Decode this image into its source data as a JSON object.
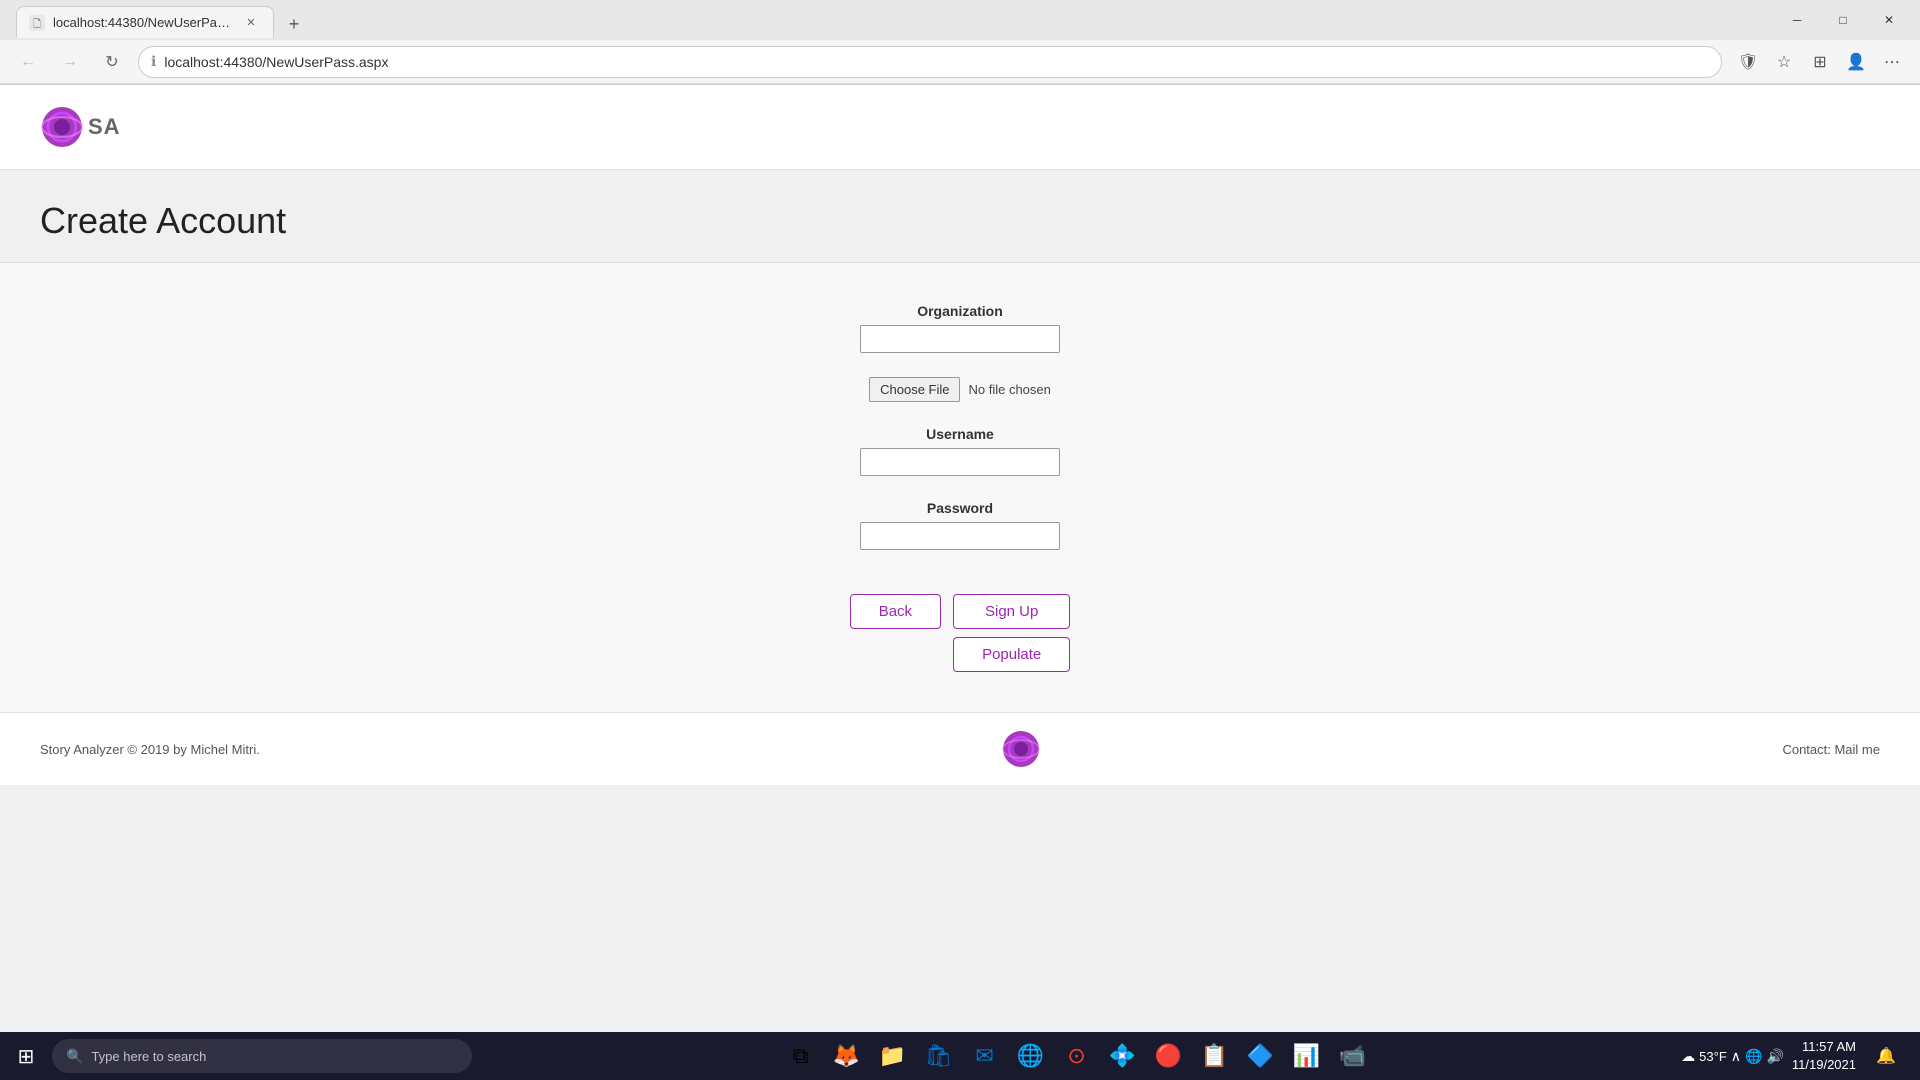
{
  "browser": {
    "tab_title": "localhost:44380/NewUserPass.as...",
    "url": "localhost:44380/NewUserPass.aspx",
    "new_tab_icon": "+",
    "nav": {
      "back_label": "←",
      "forward_label": "→",
      "refresh_label": "↻"
    },
    "window_controls": {
      "minimize": "─",
      "maximize": "□",
      "close": "✕"
    }
  },
  "logo": {
    "text": "SA"
  },
  "page_title": "Create Account",
  "form": {
    "organization_label": "Organization",
    "organization_placeholder": "",
    "choose_file_label": "Choose File",
    "no_file_text": "No file chosen",
    "username_label": "Username",
    "username_placeholder": "",
    "password_label": "Password",
    "password_placeholder": "",
    "back_button": "Back",
    "signup_button": "Sign Up",
    "populate_button": "Populate"
  },
  "footer": {
    "copyright": "Story Analyzer © 2019 by Michel Mitri.",
    "contact": "Contact: Mail me"
  },
  "taskbar": {
    "search_placeholder": "Type here to search",
    "time": "11:57 AM",
    "date": "11/19/2021",
    "temperature": "53°F"
  }
}
